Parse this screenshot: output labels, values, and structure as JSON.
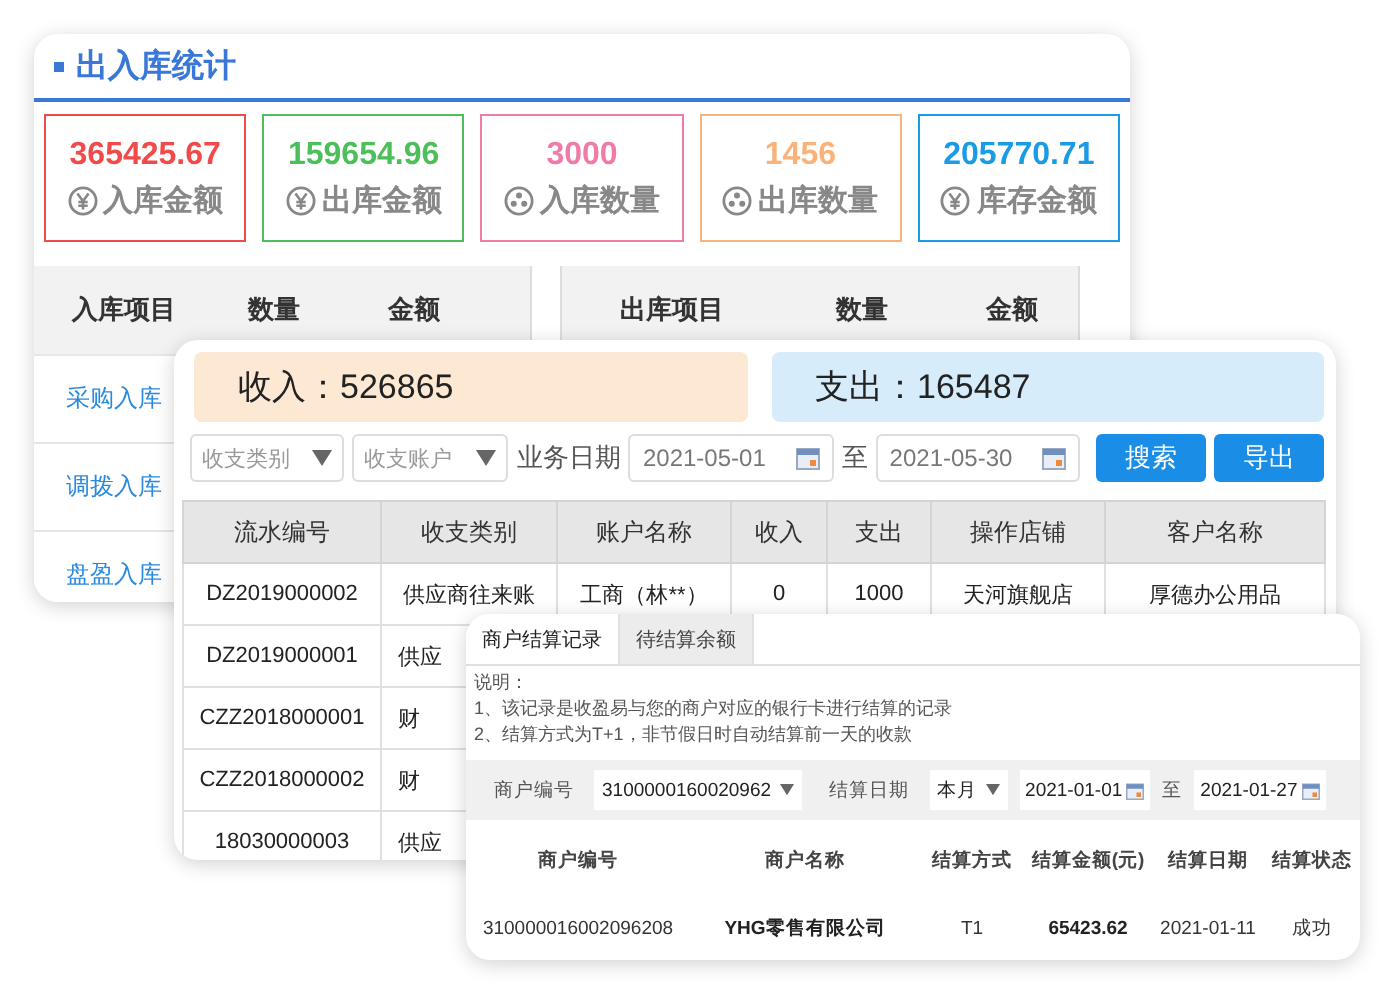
{
  "stats_panel": {
    "title": "出入库统计",
    "stats": [
      {
        "value": "365425.67",
        "label": "入库金额",
        "kind": "money",
        "color": "#f04a4a"
      },
      {
        "value": "159654.96",
        "label": "出库金额",
        "kind": "money",
        "color": "#4cbf5a"
      },
      {
        "value": "3000",
        "label": "入库数量",
        "kind": "quantity",
        "color": "#f07aa8"
      },
      {
        "value": "1456",
        "label": "出库数量",
        "kind": "quantity",
        "color": "#f9b27a"
      },
      {
        "value": "205770.71",
        "label": "库存金额",
        "kind": "money",
        "color": "#1a9be6"
      }
    ],
    "in_table": {
      "columns": [
        "入库项目",
        "数量",
        "金额"
      ],
      "rows": [
        "采购入库",
        "调拨入库",
        "盘盈入库"
      ]
    },
    "out_table": {
      "columns": [
        "出库项目",
        "数量",
        "金额"
      ]
    }
  },
  "ledger": {
    "income": "收入：526865",
    "expense": "支出：165487",
    "filters": {
      "category": {
        "placeholder": "收支类别"
      },
      "account": {
        "placeholder": "收支账户"
      },
      "date_label": "业务日期",
      "from": "2021-05-01",
      "to_label": "至",
      "to": "2021-05-30"
    },
    "buttons": [
      "搜索",
      "导出"
    ],
    "table": {
      "columns": [
        "流水编号",
        "收支类别",
        "账户名称",
        "收入",
        "支出",
        "操作店铺",
        "客户名称"
      ],
      "rows": [
        [
          "DZ2019000002",
          "供应商往来账",
          "工商（林**）",
          "0",
          "1000",
          "天河旗舰店",
          "厚德办公用品"
        ],
        [
          "DZ2019000001",
          "供应"
        ],
        [
          "CZZ2018000001",
          "财"
        ],
        [
          "CZZ2018000002",
          "财"
        ],
        [
          "18030000003",
          "供应"
        ]
      ]
    }
  },
  "settlement": {
    "tabs": [
      {
        "label": "商户结算记录",
        "selected": true
      },
      {
        "label": "待结算余额",
        "selected": false
      }
    ],
    "notes": [
      "说明：",
      "1、该记录是收盈易与您的商户对应的银行卡进行结算的记录",
      "2、结算方式为T+1，非节假日时自动结算前一天的收款"
    ],
    "filters": {
      "merchant_label": "商户编号",
      "merchant": "3100000160020962",
      "date_label": "结算日期",
      "period": "本月",
      "from": "2021-01-01",
      "to_label": "至",
      "to": "2021-01-27"
    },
    "table": {
      "columns": [
        "商户编号",
        "商户名称",
        "结算方式",
        "结算金额(元)",
        "结算日期",
        "结算状态"
      ],
      "rows": [
        [
          "310000016002096208",
          "YHG零售有限公司",
          "T1",
          "65423.62",
          "2021-01-11",
          "成功"
        ]
      ]
    }
  }
}
